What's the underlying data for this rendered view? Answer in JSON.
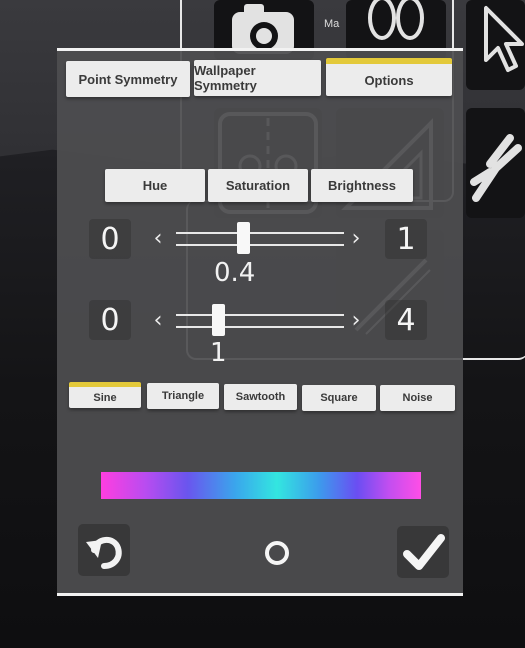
{
  "background": {
    "label_ma": "Ma"
  },
  "tabs": [
    {
      "label": "Point Symmetry",
      "active": false
    },
    {
      "label": "Wallpaper Symmetry",
      "active": false
    },
    {
      "label": "Options",
      "active": true
    }
  ],
  "adjust_buttons": [
    {
      "label": "Hue"
    },
    {
      "label": "Saturation"
    },
    {
      "label": "Brightness"
    }
  ],
  "slider1": {
    "min": "0",
    "max": "1",
    "value": "0.4",
    "fraction": 0.4
  },
  "slider2": {
    "min": "0",
    "max": "4",
    "value": "1",
    "fraction": 0.25
  },
  "waveforms": [
    {
      "label": "Sine",
      "active": true
    },
    {
      "label": "Triangle",
      "active": false
    },
    {
      "label": "Sawtooth",
      "active": false
    },
    {
      "label": "Square",
      "active": false
    },
    {
      "label": "Noise",
      "active": false
    }
  ],
  "colors": {
    "accent": "#e3c93a",
    "panel": "#4e4e50"
  },
  "icons": {
    "undo": "undo-icon",
    "center": "circle-icon",
    "confirm": "check-icon"
  }
}
